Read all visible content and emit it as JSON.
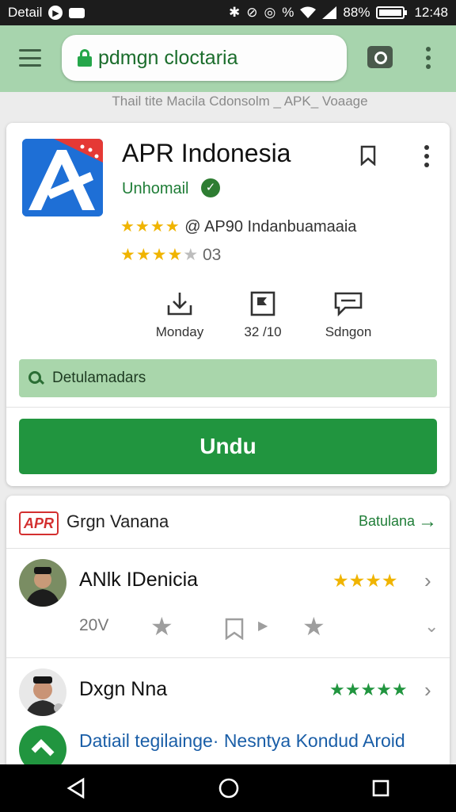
{
  "status_bar": {
    "left_label": "Detail",
    "battery_percent": "88%",
    "time": "12:48"
  },
  "browser": {
    "url": "pdmgn cloctaria",
    "subtitle": "Thail tite Macila Cdonsolm _ APK_ Voaage"
  },
  "app": {
    "name": "APR Indonesia",
    "developer": "Unhomail",
    "rating_stars": "★★★★",
    "rating_text": "@ AP90 Indanbuamaaia",
    "rating2_stars_filled": "★★★★",
    "rating2_stars_empty": "★",
    "rating2_value": "03",
    "stats": [
      {
        "label": "Monday",
        "icon": "download-icon"
      },
      {
        "label": "32 /10",
        "icon": "flag-icon"
      },
      {
        "label": "Sdngon",
        "icon": "message-icon"
      }
    ],
    "search_strip_label": "Detulamadars",
    "install_label": "Undu"
  },
  "reviews": {
    "badge": "APR",
    "section_title": "Grgn Vanana",
    "see_all": "Batulana",
    "items": [
      {
        "name": "ANlk IDenicia",
        "stars": "★★★★",
        "stars_color": "#f0b400",
        "meta_count": "20V"
      },
      {
        "name": "Dxgn Nna",
        "stars": "★★★★★",
        "stars_color": "#21953f"
      }
    ],
    "partial_text": "Datiail tegilainge· Nesntya Kondud Aroid"
  },
  "colors": {
    "accent_green": "#21953f",
    "toolbar_bg": "#a7d4ad",
    "star_yellow": "#f0b400"
  }
}
